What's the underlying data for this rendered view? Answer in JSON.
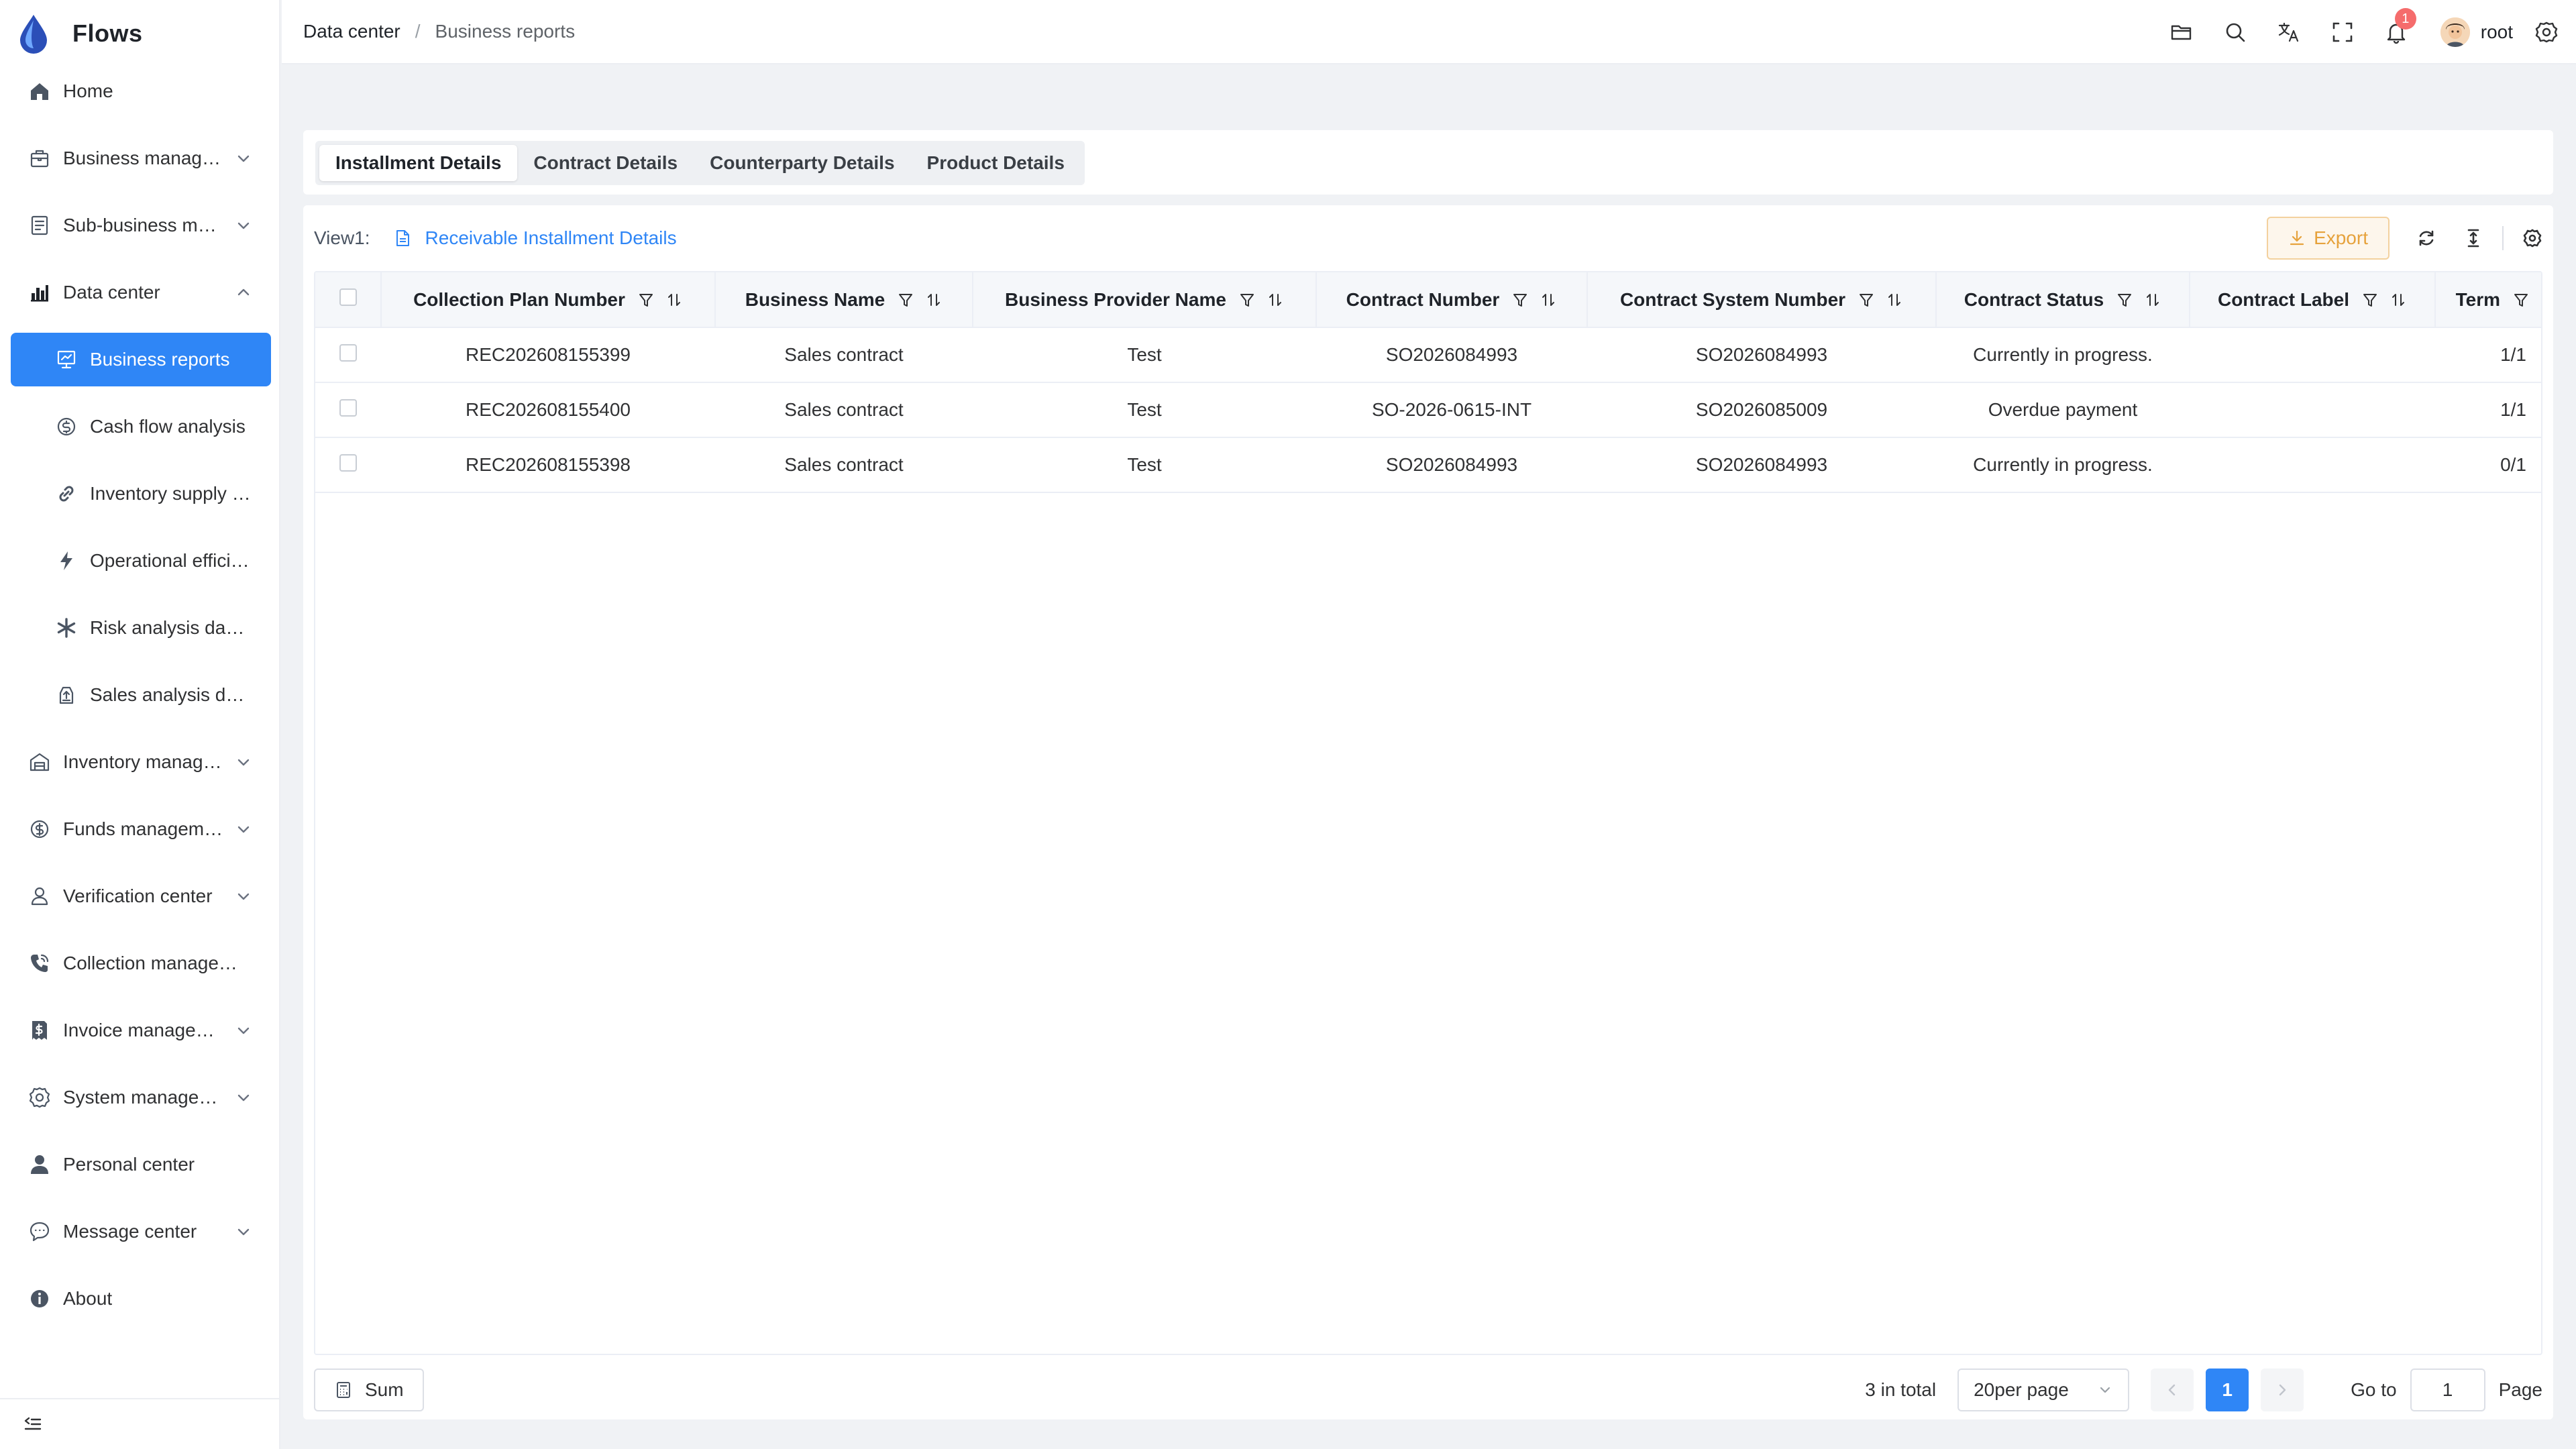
{
  "app": {
    "title": "Flows"
  },
  "sidebar": {
    "items": [
      {
        "label": "Home",
        "icon": "home-icon",
        "expandable": false
      },
      {
        "label": "Business management",
        "icon": "briefcase-icon",
        "expandable": true
      },
      {
        "label": "Sub-business management",
        "icon": "document-icon",
        "expandable": true
      },
      {
        "label": "Data center",
        "icon": "bar-chart-icon",
        "expandable": true,
        "expanded": true
      },
      {
        "label": "Business reports",
        "icon": "report-icon",
        "sub": true,
        "active": true
      },
      {
        "label": "Cash flow analysis",
        "icon": "cash-icon",
        "sub": true
      },
      {
        "label": "Inventory supply chain",
        "icon": "link-icon",
        "sub": true
      },
      {
        "label": "Operational efficiency",
        "icon": "lightning-icon",
        "sub": true
      },
      {
        "label": "Risk analysis dashboard",
        "icon": "asterisk-icon",
        "sub": true
      },
      {
        "label": "Sales analysis dashboard",
        "icon": "sales-icon",
        "sub": true
      },
      {
        "label": "Inventory management",
        "icon": "warehouse-icon",
        "expandable": true
      },
      {
        "label": "Funds management",
        "icon": "dollar-icon",
        "expandable": true
      },
      {
        "label": "Verification center",
        "icon": "verify-icon",
        "expandable": true
      },
      {
        "label": "Collection management",
        "icon": "phone-icon",
        "expandable": false
      },
      {
        "label": "Invoice management",
        "icon": "invoice-icon",
        "expandable": true
      },
      {
        "label": "System management",
        "icon": "settings-icon",
        "expandable": true
      },
      {
        "label": "Personal center",
        "icon": "person-icon",
        "expandable": false
      },
      {
        "label": "Message center",
        "icon": "message-icon",
        "expandable": true
      },
      {
        "label": "About",
        "icon": "info-icon",
        "expandable": false
      }
    ]
  },
  "header": {
    "breadcrumb": [
      "Data center",
      "Business reports"
    ],
    "notification_count": "1",
    "user_name": "root"
  },
  "tabs": [
    {
      "label": "Installment Details",
      "active": true
    },
    {
      "label": "Contract Details"
    },
    {
      "label": "Counterparty Details"
    },
    {
      "label": "Product Details"
    }
  ],
  "toolbar": {
    "view_label": "View1:",
    "view_name": "Receivable Installment Details",
    "export_label": "Export"
  },
  "table": {
    "columns": [
      {
        "label": "Collection Plan Number",
        "filter": true,
        "sort": true
      },
      {
        "label": "Business Name",
        "filter": true,
        "sort": true
      },
      {
        "label": "Business Provider Name",
        "filter": true,
        "sort": true
      },
      {
        "label": "Contract Number",
        "filter": true,
        "sort": true
      },
      {
        "label": "Contract System Number",
        "filter": true,
        "sort": true
      },
      {
        "label": "Contract Status",
        "filter": true,
        "sort": true
      },
      {
        "label": "Contract Label",
        "filter": true,
        "sort": true
      },
      {
        "label": "Term",
        "filter": true,
        "sort": false
      }
    ],
    "rows": [
      [
        "REC202608155399",
        "Sales contract",
        "Test",
        "SO2026084993",
        "SO2026084993",
        "Currently in progress.",
        "",
        "1/1"
      ],
      [
        "REC202608155400",
        "Sales contract",
        "Test",
        "SO-2026-0615-INT",
        "SO2026085009",
        "Overdue payment",
        "",
        "1/1"
      ],
      [
        "REC202608155398",
        "Sales contract",
        "Test",
        "SO2026084993",
        "SO2026084993",
        "Currently in progress.",
        "",
        "0/1"
      ]
    ]
  },
  "footer": {
    "sum_label": "Sum",
    "total_text": "3 in total",
    "page_size": "20per page",
    "current_page": "1",
    "goto_label": "Go to",
    "goto_value": "1",
    "page_label": "Page"
  },
  "colors": {
    "accent": "#2f86f6",
    "export_text": "#e6a23c",
    "badge": "#f56c6c"
  }
}
